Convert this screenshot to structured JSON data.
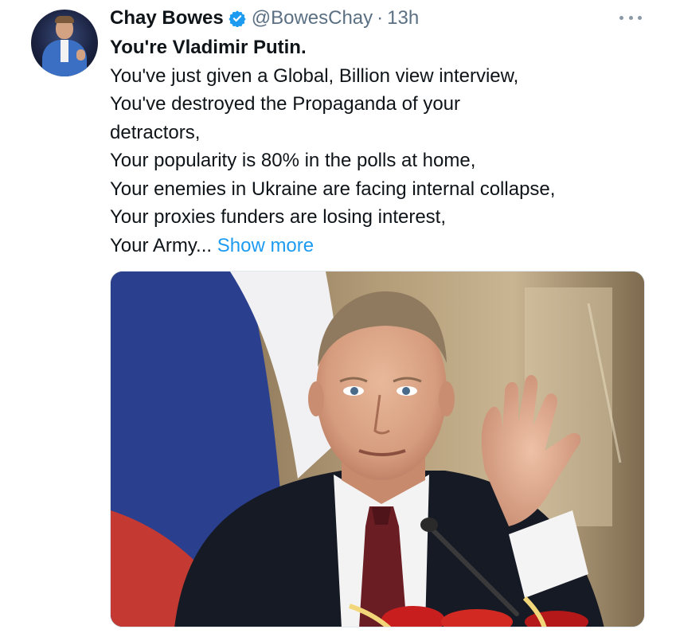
{
  "tweet": {
    "author": {
      "name": "Chay Bowes",
      "verified_icon": "verified-badge-icon",
      "handle": "@BowesChay",
      "separator": "·",
      "time": "13h"
    },
    "more_icon": "more-options-icon",
    "text": {
      "headline": "You're Vladimir Putin.",
      "lines": [
        "You've just given a Global, Billion view interview,",
        "You've destroyed the Propaganda of your",
        "detractors,",
        "Your popularity is 80% in the polls at home,",
        "Your enemies in Ukraine are facing internal collapse,",
        "Your proxies funders are losing interest,"
      ],
      "last_line": "Your Army...",
      "show_more": "Show more"
    },
    "media": {
      "description_icon": "photo"
    }
  },
  "colors": {
    "text": "#0f1419",
    "secondary": "#5b7083",
    "link": "#1d9bf0",
    "verified": "#1d9bf0"
  }
}
